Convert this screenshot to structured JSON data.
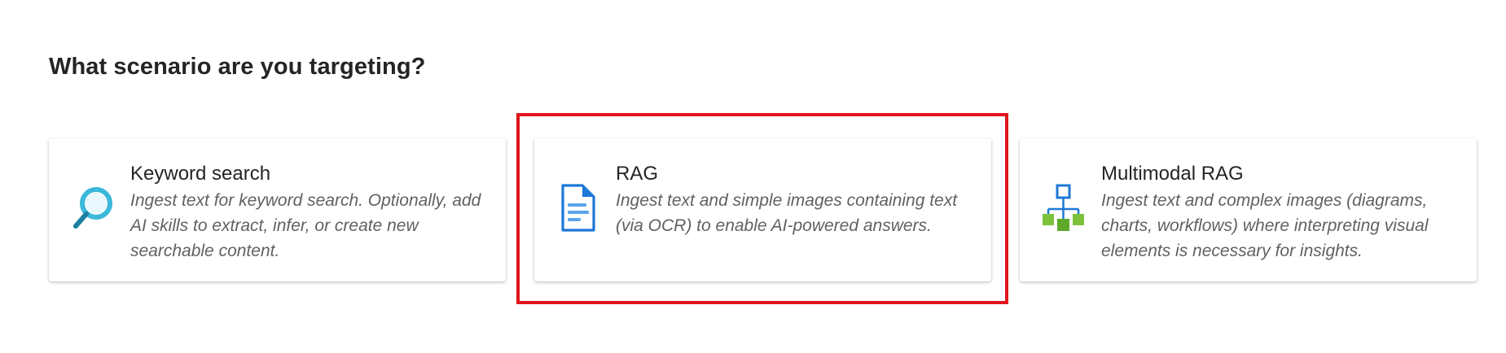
{
  "heading": "What scenario are you targeting?",
  "cards": [
    {
      "title": "Keyword search",
      "description": "Ingest text for keyword search. Optionally, add AI skills to extract, infer, or create new searchable content.",
      "icon": "magnifier-icon"
    },
    {
      "title": "RAG",
      "description": "Ingest text and simple images containing text (via OCR) to enable AI-powered answers.",
      "icon": "document-icon"
    },
    {
      "title": "Multimodal RAG",
      "description": "Ingest text and complex images (diagrams, charts, workflows) where interpreting visual elements is necessary for insights.",
      "icon": "hierarchy-icon"
    }
  ],
  "colors": {
    "highlight_border": "#e0141e",
    "search_icon": "#3bb8da",
    "document_icon": "#1e78d7",
    "hierarchy_top": "#1e78d7",
    "hierarchy_bottom": "#7cc23a"
  }
}
